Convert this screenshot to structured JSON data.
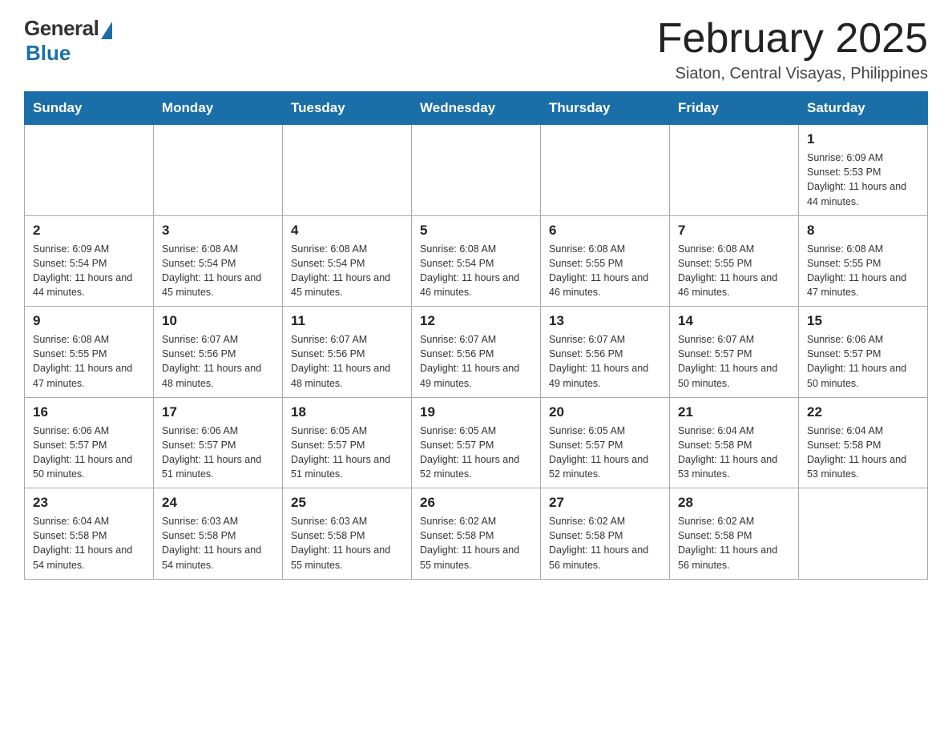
{
  "logo": {
    "general": "General",
    "blue": "Blue"
  },
  "header": {
    "title": "February 2025",
    "subtitle": "Siaton, Central Visayas, Philippines"
  },
  "weekdays": [
    "Sunday",
    "Monday",
    "Tuesday",
    "Wednesday",
    "Thursday",
    "Friday",
    "Saturday"
  ],
  "weeks": [
    [
      {
        "day": "",
        "info": ""
      },
      {
        "day": "",
        "info": ""
      },
      {
        "day": "",
        "info": ""
      },
      {
        "day": "",
        "info": ""
      },
      {
        "day": "",
        "info": ""
      },
      {
        "day": "",
        "info": ""
      },
      {
        "day": "1",
        "info": "Sunrise: 6:09 AM\nSunset: 5:53 PM\nDaylight: 11 hours\nand 44 minutes."
      }
    ],
    [
      {
        "day": "2",
        "info": "Sunrise: 6:09 AM\nSunset: 5:54 PM\nDaylight: 11 hours\nand 44 minutes."
      },
      {
        "day": "3",
        "info": "Sunrise: 6:08 AM\nSunset: 5:54 PM\nDaylight: 11 hours\nand 45 minutes."
      },
      {
        "day": "4",
        "info": "Sunrise: 6:08 AM\nSunset: 5:54 PM\nDaylight: 11 hours\nand 45 minutes."
      },
      {
        "day": "5",
        "info": "Sunrise: 6:08 AM\nSunset: 5:54 PM\nDaylight: 11 hours\nand 46 minutes."
      },
      {
        "day": "6",
        "info": "Sunrise: 6:08 AM\nSunset: 5:55 PM\nDaylight: 11 hours\nand 46 minutes."
      },
      {
        "day": "7",
        "info": "Sunrise: 6:08 AM\nSunset: 5:55 PM\nDaylight: 11 hours\nand 46 minutes."
      },
      {
        "day": "8",
        "info": "Sunrise: 6:08 AM\nSunset: 5:55 PM\nDaylight: 11 hours\nand 47 minutes."
      }
    ],
    [
      {
        "day": "9",
        "info": "Sunrise: 6:08 AM\nSunset: 5:55 PM\nDaylight: 11 hours\nand 47 minutes."
      },
      {
        "day": "10",
        "info": "Sunrise: 6:07 AM\nSunset: 5:56 PM\nDaylight: 11 hours\nand 48 minutes."
      },
      {
        "day": "11",
        "info": "Sunrise: 6:07 AM\nSunset: 5:56 PM\nDaylight: 11 hours\nand 48 minutes."
      },
      {
        "day": "12",
        "info": "Sunrise: 6:07 AM\nSunset: 5:56 PM\nDaylight: 11 hours\nand 49 minutes."
      },
      {
        "day": "13",
        "info": "Sunrise: 6:07 AM\nSunset: 5:56 PM\nDaylight: 11 hours\nand 49 minutes."
      },
      {
        "day": "14",
        "info": "Sunrise: 6:07 AM\nSunset: 5:57 PM\nDaylight: 11 hours\nand 50 minutes."
      },
      {
        "day": "15",
        "info": "Sunrise: 6:06 AM\nSunset: 5:57 PM\nDaylight: 11 hours\nand 50 minutes."
      }
    ],
    [
      {
        "day": "16",
        "info": "Sunrise: 6:06 AM\nSunset: 5:57 PM\nDaylight: 11 hours\nand 50 minutes."
      },
      {
        "day": "17",
        "info": "Sunrise: 6:06 AM\nSunset: 5:57 PM\nDaylight: 11 hours\nand 51 minutes."
      },
      {
        "day": "18",
        "info": "Sunrise: 6:05 AM\nSunset: 5:57 PM\nDaylight: 11 hours\nand 51 minutes."
      },
      {
        "day": "19",
        "info": "Sunrise: 6:05 AM\nSunset: 5:57 PM\nDaylight: 11 hours\nand 52 minutes."
      },
      {
        "day": "20",
        "info": "Sunrise: 6:05 AM\nSunset: 5:57 PM\nDaylight: 11 hours\nand 52 minutes."
      },
      {
        "day": "21",
        "info": "Sunrise: 6:04 AM\nSunset: 5:58 PM\nDaylight: 11 hours\nand 53 minutes."
      },
      {
        "day": "22",
        "info": "Sunrise: 6:04 AM\nSunset: 5:58 PM\nDaylight: 11 hours\nand 53 minutes."
      }
    ],
    [
      {
        "day": "23",
        "info": "Sunrise: 6:04 AM\nSunset: 5:58 PM\nDaylight: 11 hours\nand 54 minutes."
      },
      {
        "day": "24",
        "info": "Sunrise: 6:03 AM\nSunset: 5:58 PM\nDaylight: 11 hours\nand 54 minutes."
      },
      {
        "day": "25",
        "info": "Sunrise: 6:03 AM\nSunset: 5:58 PM\nDaylight: 11 hours\nand 55 minutes."
      },
      {
        "day": "26",
        "info": "Sunrise: 6:02 AM\nSunset: 5:58 PM\nDaylight: 11 hours\nand 55 minutes."
      },
      {
        "day": "27",
        "info": "Sunrise: 6:02 AM\nSunset: 5:58 PM\nDaylight: 11 hours\nand 56 minutes."
      },
      {
        "day": "28",
        "info": "Sunrise: 6:02 AM\nSunset: 5:58 PM\nDaylight: 11 hours\nand 56 minutes."
      },
      {
        "day": "",
        "info": ""
      }
    ]
  ]
}
